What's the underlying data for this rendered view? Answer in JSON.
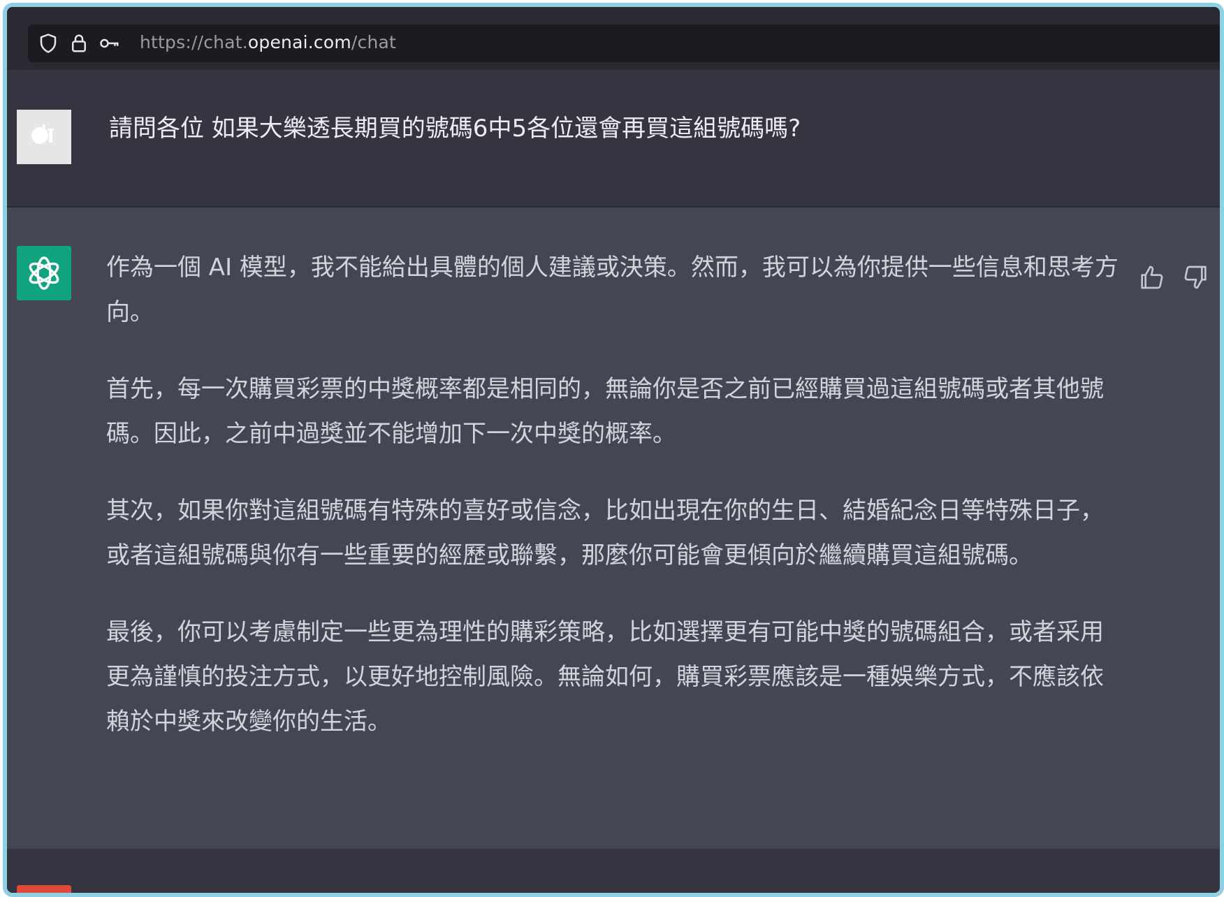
{
  "browser": {
    "url_prefix": "https://chat.",
    "url_domain": "openai.com",
    "url_path": "/chat",
    "icons": [
      "shield-icon",
      "lock-icon",
      "key-icon"
    ]
  },
  "conversation": {
    "user_message": "請問各位 如果大樂透長期買的號碼6中5各位還會再買這組號碼嗎?",
    "assistant_paragraphs": [
      "作為一個 AI 模型，我不能給出具體的個人建議或決策。然而，我可以為你提供一些信息和思考方向。",
      "首先，每一次購買彩票的中獎概率都是相同的，無論你是否之前已經購買過這組號碼或者其他號碼。因此，之前中過獎並不能增加下一次中獎的概率。",
      "其次，如果你對這組號碼有特殊的喜好或信念，比如出現在你的生日、結婚紀念日等特殊日子，或者這組號碼與你有一些重要的經歷或聯繫，那麼你可能會更傾向於繼續購買這組號碼。",
      "最後，你可以考慮制定一些更為理性的購彩策略，比如選擇更有可能中獎的號碼組合，或者采用更為謹慎的投注方式，以更好地控制風險。無論如何，購買彩票應該是一種娛樂方式，不應該依賴於中獎來改變你的生活。"
    ]
  },
  "colors": {
    "user_row_bg": "#343541",
    "assistant_row_bg": "#444654",
    "assistant_avatar_bg": "#10a37f",
    "frame_border": "#8fd0e6",
    "next_avatar_bg": "#e0483c"
  }
}
